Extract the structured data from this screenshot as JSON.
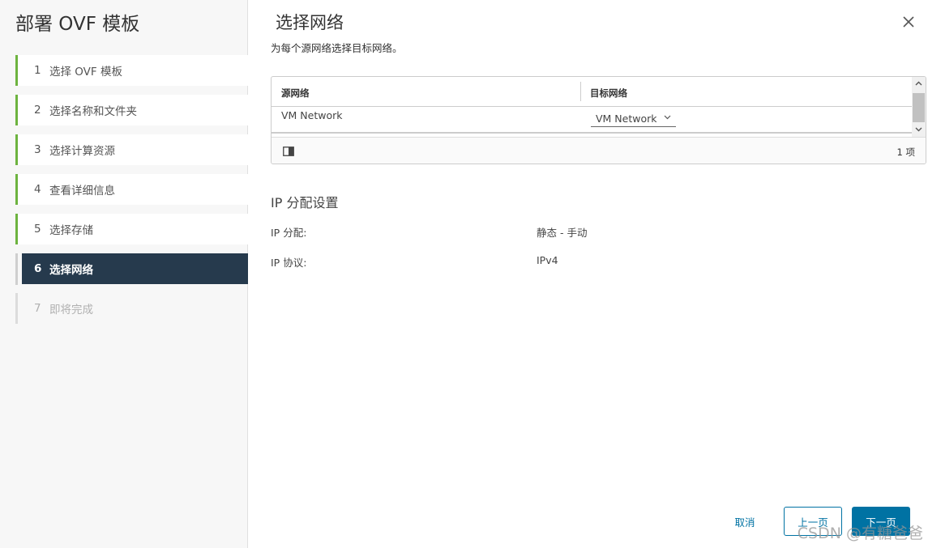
{
  "wizard": {
    "title": "部署 OVF 模板"
  },
  "steps": [
    {
      "num": "1",
      "label": "选择 OVF 模板"
    },
    {
      "num": "2",
      "label": "选择名称和文件夹"
    },
    {
      "num": "3",
      "label": "选择计算资源"
    },
    {
      "num": "4",
      "label": "查看详细信息"
    },
    {
      "num": "5",
      "label": "选择存储"
    },
    {
      "num": "6",
      "label": "选择网络"
    },
    {
      "num": "7",
      "label": "即将完成"
    }
  ],
  "page": {
    "title": "选择网络",
    "subtitle": "为每个源网络选择目标网络。"
  },
  "grid": {
    "headers": {
      "source": "源网络",
      "target": "目标网络"
    },
    "rows": [
      {
        "source": "VM Network",
        "target": "VM Network"
      }
    ],
    "footer_count": "1 项"
  },
  "ip": {
    "section_title": "IP 分配设置",
    "allocation_label": "IP 分配:",
    "allocation_value": "静态 - 手动",
    "protocol_label": "IP 协议:",
    "protocol_value": "IPv4"
  },
  "buttons": {
    "cancel": "取消",
    "back": "上一页",
    "next": "下一页"
  },
  "watermark": "CSDN @有糖爸爸",
  "colors": {
    "accent": "#0072a3",
    "active_step": "#263a4d",
    "completed": "#6db33f"
  }
}
